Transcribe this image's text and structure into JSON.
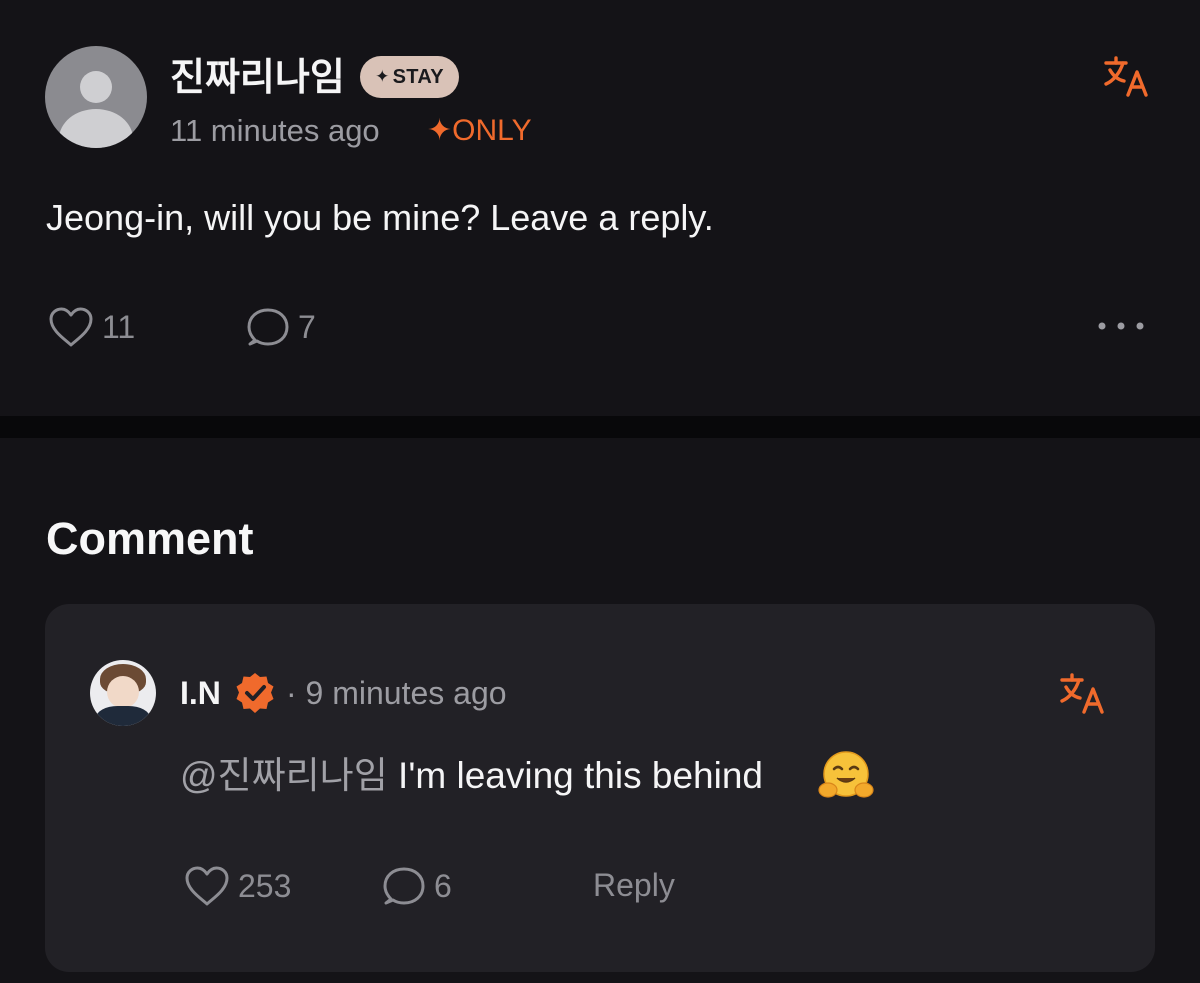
{
  "post": {
    "author": "진짜리나임",
    "badge": {
      "symbol": "✦",
      "label": "STAY"
    },
    "time": "11 minutes ago",
    "only_tag": {
      "symbol": "✦",
      "label": "ONLY"
    },
    "text": "Jeong-in, will you be mine? Leave a reply.",
    "likes": "11",
    "comments": "7"
  },
  "comments_section": {
    "title": "Comment",
    "items": [
      {
        "author": "I.N",
        "meta": "· 9 minutes ago",
        "mention": "@진짜리나임",
        "text": " I'm leaving this behind",
        "emoji": "hugging-face",
        "likes": "253",
        "replies": "6",
        "reply_label": "Reply"
      }
    ]
  },
  "colors": {
    "accent_orange": "#f06a2c",
    "badge_bg": "#d9c2b7",
    "background": "#141317",
    "card_bg": "#222126",
    "muted_text": "#9c9ca2"
  },
  "icons": [
    "translate-icon",
    "heart-icon",
    "comment-icon",
    "more-icon",
    "verified-icon",
    "hugging-face-emoji"
  ]
}
